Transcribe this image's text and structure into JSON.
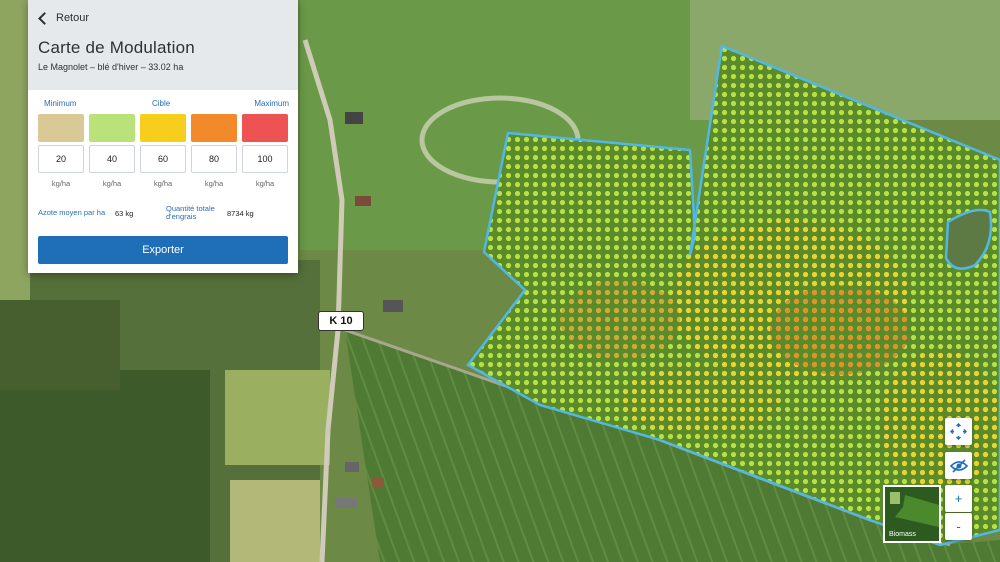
{
  "panel": {
    "back_label": "Retour",
    "title": "Carte de Modulation",
    "subtitle": "Le Magnolet – blé d'hiver – 33.02 ha",
    "scale_labels": {
      "min": "Minimum",
      "target": "Cible",
      "max": "Maximum"
    },
    "levels": [
      {
        "value": "20",
        "unit": "kg/ha",
        "color": "#d8c997"
      },
      {
        "value": "40",
        "unit": "kg/ha",
        "color": "#b9e27a"
      },
      {
        "value": "60",
        "unit": "kg/ha",
        "color": "#f6cf1d"
      },
      {
        "value": "80",
        "unit": "kg/ha",
        "color": "#f28a2b"
      },
      {
        "value": "100",
        "unit": "kg/ha",
        "color": "#ee5252"
      }
    ],
    "stats": {
      "avg_label": "Azote moyen par ha",
      "avg_value": "63 kg",
      "total_label_1": "Quantité totale",
      "total_label_2": "d'engrais",
      "total_value": "8734 kg"
    },
    "export_label": "Exporter"
  },
  "map": {
    "road_label": "K 10",
    "layer_label": "Biomass",
    "zoom_in": "+",
    "zoom_out": "-"
  },
  "colors": {
    "accent": "#1e6fb7",
    "field_border": "#4fb8e8"
  }
}
